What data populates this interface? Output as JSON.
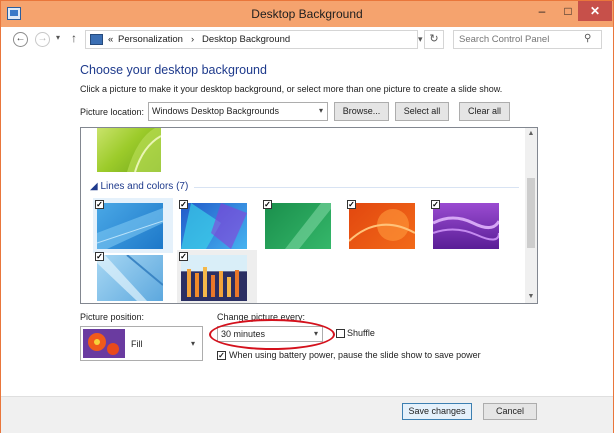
{
  "window": {
    "title": "Desktop Background",
    "minimize": "–",
    "maximize": "□",
    "close": "✕"
  },
  "address": {
    "overflow": "«",
    "breadcrumbs": [
      "Personalization",
      "Desktop Background"
    ],
    "separator": "›",
    "search_placeholder": "Search Control Panel"
  },
  "main": {
    "heading": "Choose your desktop background",
    "subtext": "Click a picture to make it your desktop background, or select more than one picture to create a slide show.",
    "picture_location_label": "Picture location:",
    "picture_location_value": "Windows Desktop Backgrounds",
    "browse_label": "Browse...",
    "select_all_label": "Select all",
    "clear_all_label": "Clear all"
  },
  "gallery": {
    "group_title": "Lines and colors (7)",
    "group_arrow": "◢",
    "check_mark": "✓"
  },
  "options": {
    "picture_position_label": "Picture position:",
    "picture_position_value": "Fill",
    "change_picture_label": "Change picture every:",
    "change_picture_value": "30 minutes",
    "shuffle_label": "Shuffle",
    "battery_label": "When using battery power, pause the slide show to save power"
  },
  "footer": {
    "save_label": "Save changes",
    "cancel_label": "Cancel"
  }
}
